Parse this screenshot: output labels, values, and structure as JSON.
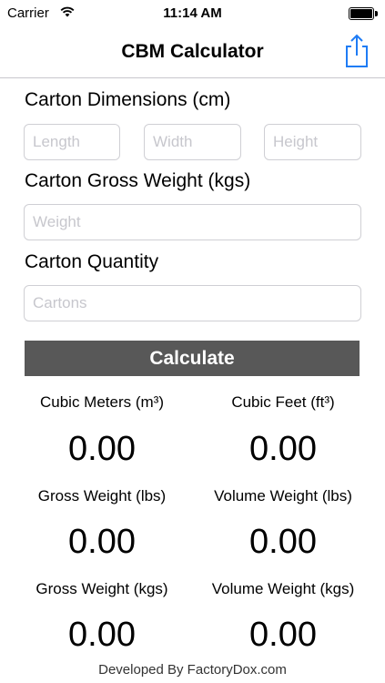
{
  "status_bar": {
    "carrier": "Carrier",
    "time": "11:14 AM"
  },
  "nav": {
    "title": "CBM Calculator",
    "share_icon": "share-icon",
    "accent_color": "#1f7cf5"
  },
  "dimensions": {
    "label": "Carton Dimensions (cm)",
    "length_placeholder": "Length",
    "width_placeholder": "Width",
    "height_placeholder": "Height"
  },
  "weight": {
    "label": "Carton Gross Weight (kgs)",
    "placeholder": "Weight"
  },
  "quantity": {
    "label": "Carton Quantity",
    "placeholder": "Cartons"
  },
  "calculate_label": "Calculate",
  "results": {
    "cubic_meters": {
      "label": "Cubic Meters (m³)",
      "value": "0.00"
    },
    "cubic_feet": {
      "label": "Cubic Feet (ft³)",
      "value": "0.00"
    },
    "gross_weight_lbs": {
      "label": "Gross Weight (lbs)",
      "value": "0.00"
    },
    "volume_weight_lbs": {
      "label": "Volume Weight (lbs)",
      "value": "0.00"
    },
    "gross_weight_kgs": {
      "label": "Gross Weight (kgs)",
      "value": "0.00"
    },
    "volume_weight_kgs": {
      "label": "Volume Weight (kgs)",
      "value": "0.00"
    }
  },
  "footer": "Developed By FactoryDox.com"
}
